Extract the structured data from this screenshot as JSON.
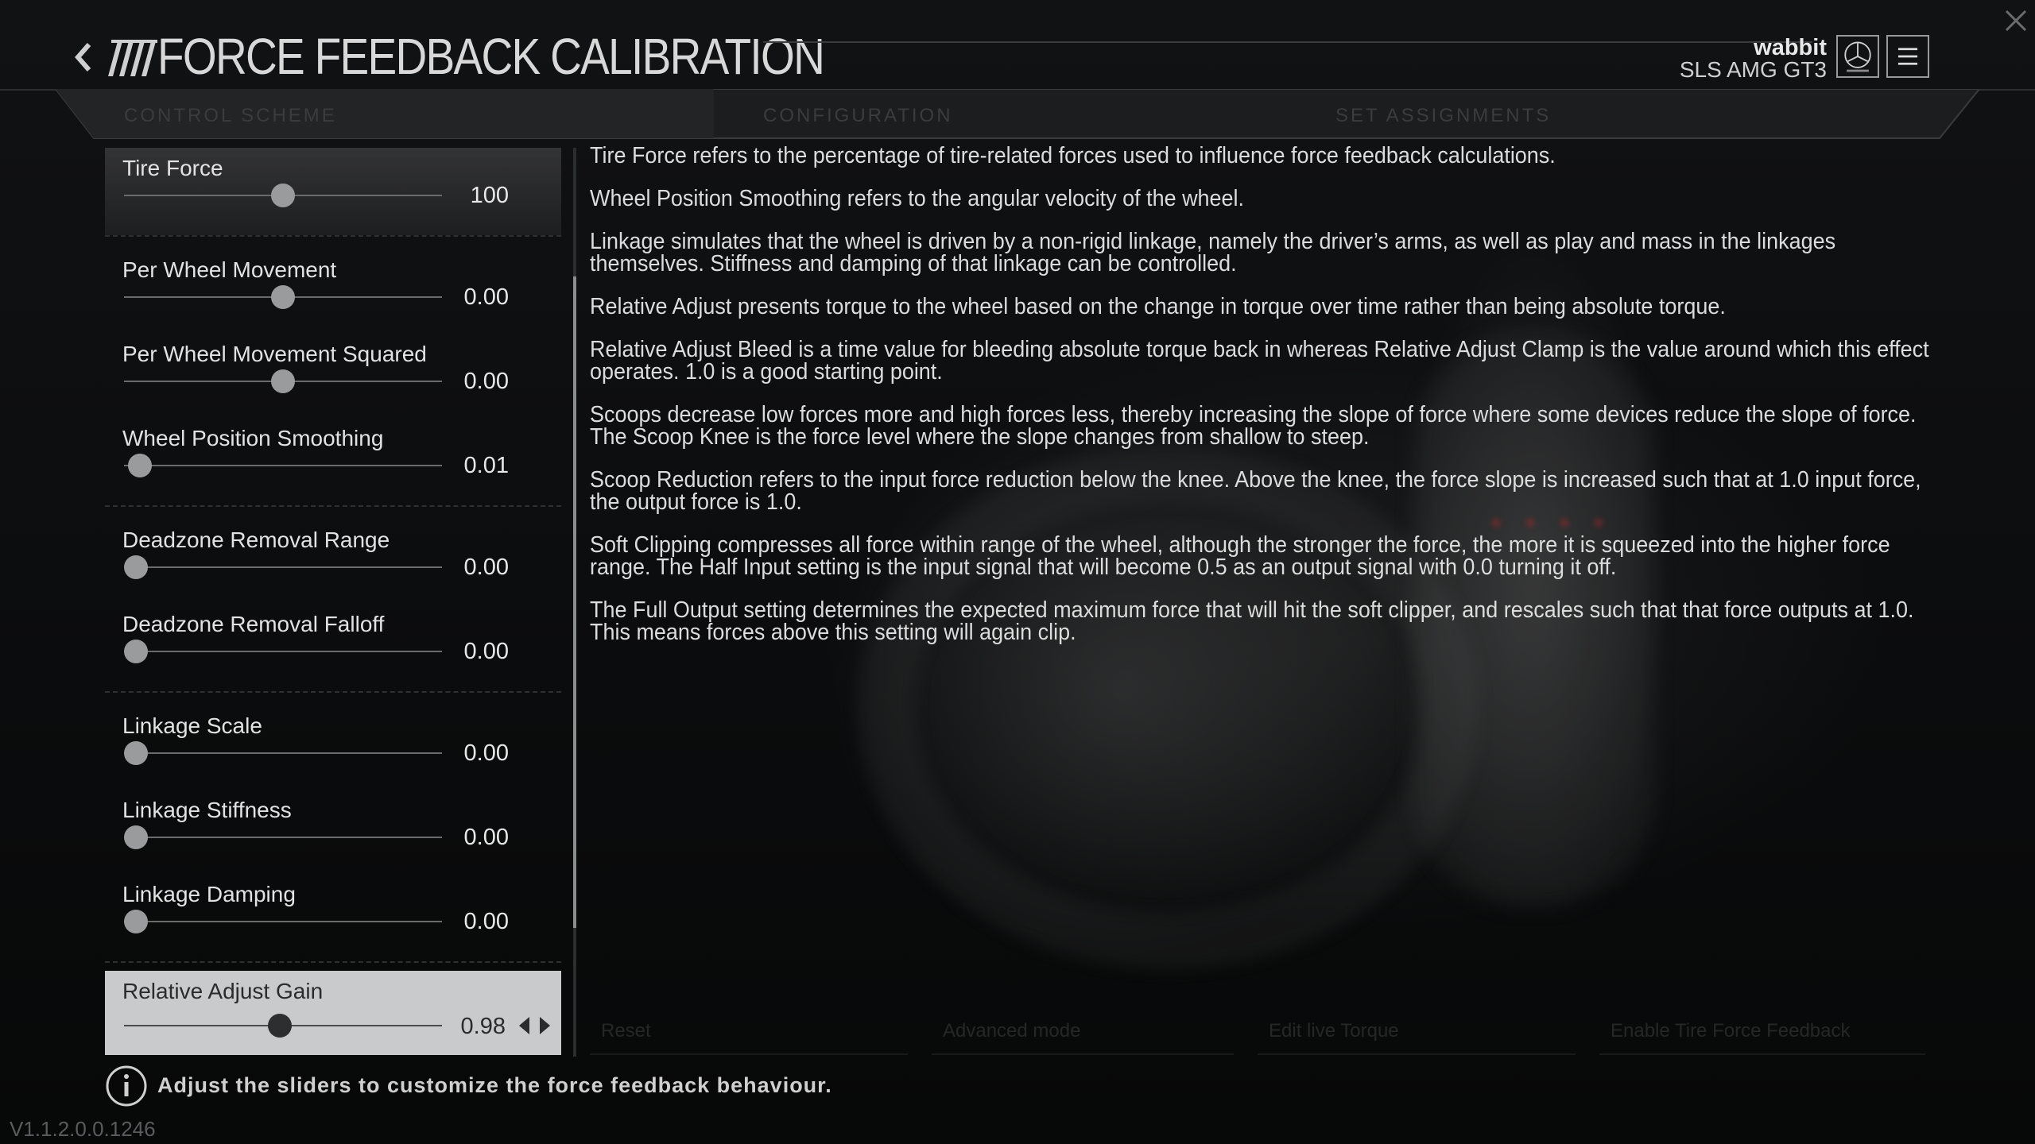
{
  "header": {
    "title": "FORCE FEEDBACK CALIBRATION",
    "username": "wabbit",
    "car": "SLS AMG GT3"
  },
  "tabs": [
    {
      "label": "CONTROL SCHEME"
    },
    {
      "label": "CONFIGURATION"
    },
    {
      "label": "SET ASSIGNMENTS"
    }
  ],
  "sliders": [
    {
      "label": "Tire Force",
      "value": "100",
      "level": 0.5
    },
    {
      "label": "Per Wheel Movement",
      "value": "0.00",
      "level": 0.5
    },
    {
      "label": "Per Wheel Movement Squared",
      "value": "0.00",
      "level": 0.5
    },
    {
      "label": "Wheel Position Smoothing",
      "value": "0.01",
      "level": 0.05
    },
    {
      "label": "Deadzone Removal Range",
      "value": "0.00",
      "level": 0.0
    },
    {
      "label": "Deadzone Removal Falloff",
      "value": "0.00",
      "level": 0.0
    },
    {
      "label": "Linkage Scale",
      "value": "0.00",
      "level": 0.0
    },
    {
      "label": "Linkage Stiffness",
      "value": "0.00",
      "level": 0.0
    },
    {
      "label": "Linkage Damping",
      "value": "0.00",
      "level": 0.0
    },
    {
      "label": "Relative Adjust Gain",
      "value": "0.98",
      "level": 0.49
    }
  ],
  "descriptions": [
    "Tire Force refers to the percentage of tire-related forces used to influence force feedback calculations.",
    "Wheel Position Smoothing refers to the angular velocity of the wheel.",
    "Linkage simulates that the wheel is driven by a non-rigid linkage, namely the driver’s arms, as well as play and mass in the linkages themselves. Stiffness and damping of that linkage can be controlled.",
    "Relative Adjust presents torque to the wheel based on the change in torque over time rather than being absolute torque.",
    "Relative Adjust Bleed is a time value for bleeding absolute torque back in whereas Relative Adjust Clamp is the value around which this effect operates. 1.0 is a good starting point.",
    "Scoops decrease low forces more and high forces less, thereby increasing the slope of force where some devices reduce the slope of force. The Scoop Knee is the force level where the slope changes from shallow to steep.",
    "Scoop Reduction refers to the input force reduction below the knee. Above the knee, the force slope is increased such that at 1.0 input force, the output force is 1.0.",
    "Soft Clipping compresses all force within range of the wheel, although the stronger the force, the more it is squeezed into the higher force range. The Half Input setting is the input signal that will become 0.5 as an output signal with 0.0 turning it off.",
    "The Full Output setting determines the expected maximum force that will hit the soft clipper, and rescales such that that force outputs at 1.0. This means forces above this setting will again clip."
  ],
  "footer_controls": [
    {
      "label": "Reset"
    },
    {
      "label": "Advanced mode"
    },
    {
      "label": "Edit live Torque"
    },
    {
      "label": "Enable Tire Force Feedback"
    }
  ],
  "hint": "Adjust the sliders to customize the force feedback behaviour.",
  "version": "V1.1.2.0.0.1246",
  "icons": {
    "back": "chevron-left-icon",
    "brand": "mercedes-star-icon",
    "menu": "hamburger-menu-icon",
    "close": "close-icon",
    "info": "info-icon"
  },
  "colors": {
    "background": "#0b0c0d",
    "selected_row": "#c8cacc",
    "text": "#e6e6e6"
  }
}
